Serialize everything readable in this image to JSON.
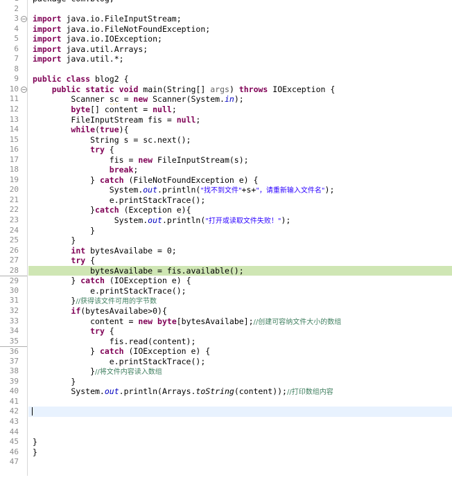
{
  "editor": {
    "language": "java",
    "class_name": "blog2",
    "first_line_number": 1,
    "total_visible_lines": 47,
    "current_line": 42,
    "highlighted_line": 28,
    "colors": {
      "keyword": "#7f0055",
      "string": "#2a00ff",
      "comment": "#3f7f5f",
      "field": "#0000c0",
      "text": "#000000",
      "gutter_text": "#8c8c8c",
      "occurrence_highlight": "#cfe6b4",
      "current_line_highlight": "#e8f2fe",
      "background": "#ffffff",
      "gutter_border": "#d7d7d7",
      "warning_squiggle": "#e8c000"
    },
    "fold_markers": [
      3,
      10
    ],
    "separator_lines": [
      29,
      36
    ],
    "lines": [
      {
        "num": 1,
        "clipped": true,
        "tokens": [
          {
            "t": "package com.blog;",
            "c": "plain"
          }
        ]
      },
      {
        "num": 2,
        "tokens": []
      },
      {
        "num": 3,
        "fold": true,
        "tokens": [
          {
            "t": "import",
            "c": "kw"
          },
          {
            "t": " java.io.FileInputStream;",
            "c": "plain"
          }
        ]
      },
      {
        "num": 4,
        "tokens": [
          {
            "t": "import",
            "c": "kw"
          },
          {
            "t": " java.io.FileNotFoundException;",
            "c": "plain"
          }
        ]
      },
      {
        "num": 5,
        "tokens": [
          {
            "t": "import",
            "c": "kw"
          },
          {
            "t": " java.io.IOException;",
            "c": "plain"
          }
        ]
      },
      {
        "num": 6,
        "tokens": [
          {
            "t": "import",
            "c": "kw"
          },
          {
            "t": " java.util.Arrays;",
            "c": "plain"
          }
        ]
      },
      {
        "num": 7,
        "tokens": [
          {
            "t": "import",
            "c": "kw"
          },
          {
            "t": " java.util.*;",
            "c": "plain"
          }
        ]
      },
      {
        "num": 8,
        "tokens": []
      },
      {
        "num": 9,
        "tokens": [
          {
            "t": "public",
            "c": "kw"
          },
          {
            "t": " ",
            "c": "plain"
          },
          {
            "t": "class",
            "c": "kw"
          },
          {
            "t": " blog2 {",
            "c": "plain"
          }
        ]
      },
      {
        "num": 10,
        "fold": true,
        "tokens": [
          {
            "t": "    ",
            "c": "plain"
          },
          {
            "t": "public",
            "c": "kw"
          },
          {
            "t": " ",
            "c": "plain"
          },
          {
            "t": "static",
            "c": "kw"
          },
          {
            "t": " ",
            "c": "plain"
          },
          {
            "t": "void",
            "c": "kw"
          },
          {
            "t": " main(String[] ",
            "c": "plain"
          },
          {
            "t": "args",
            "c": "ann"
          },
          {
            "t": ") ",
            "c": "plain"
          },
          {
            "t": "throws",
            "c": "kw"
          },
          {
            "t": " IOException {",
            "c": "plain"
          }
        ]
      },
      {
        "num": 11,
        "tokens": [
          {
            "t": "        Scanner ",
            "c": "plain"
          },
          {
            "t": "sc",
            "c": "warn"
          },
          {
            "t": " = ",
            "c": "plain"
          },
          {
            "t": "new",
            "c": "kw"
          },
          {
            "t": " Scanner(System.",
            "c": "plain"
          },
          {
            "t": "in",
            "c": "fld"
          },
          {
            "t": ");",
            "c": "plain"
          }
        ]
      },
      {
        "num": 12,
        "tokens": [
          {
            "t": "        ",
            "c": "plain"
          },
          {
            "t": "byte",
            "c": "kw"
          },
          {
            "t": "[] content = ",
            "c": "plain"
          },
          {
            "t": "null",
            "c": "kw"
          },
          {
            "t": ";",
            "c": "plain"
          }
        ]
      },
      {
        "num": 13,
        "tokens": [
          {
            "t": "        FileInputStream fis = ",
            "c": "plain"
          },
          {
            "t": "null",
            "c": "kw"
          },
          {
            "t": ";",
            "c": "plain"
          }
        ]
      },
      {
        "num": 14,
        "tokens": [
          {
            "t": "        ",
            "c": "plain"
          },
          {
            "t": "while",
            "c": "kw"
          },
          {
            "t": "(",
            "c": "plain"
          },
          {
            "t": "true",
            "c": "kw"
          },
          {
            "t": "){",
            "c": "plain"
          }
        ]
      },
      {
        "num": 15,
        "tokens": [
          {
            "t": "            String s = sc.next();",
            "c": "plain"
          }
        ]
      },
      {
        "num": 16,
        "tokens": [
          {
            "t": "            ",
            "c": "plain"
          },
          {
            "t": "try",
            "c": "kw"
          },
          {
            "t": " {",
            "c": "plain"
          }
        ]
      },
      {
        "num": 17,
        "tokens": [
          {
            "t": "                fis = ",
            "c": "plain"
          },
          {
            "t": "new",
            "c": "kw"
          },
          {
            "t": " FileInputStream(s);",
            "c": "plain"
          }
        ]
      },
      {
        "num": 18,
        "tokens": [
          {
            "t": "                ",
            "c": "plain"
          },
          {
            "t": "break",
            "c": "kw"
          },
          {
            "t": ";",
            "c": "plain"
          }
        ]
      },
      {
        "num": 19,
        "tokens": [
          {
            "t": "            } ",
            "c": "plain"
          },
          {
            "t": "catch",
            "c": "kw"
          },
          {
            "t": " (FileNotFoundException e) {",
            "c": "plain"
          }
        ]
      },
      {
        "num": 20,
        "tokens": [
          {
            "t": "                System.",
            "c": "plain"
          },
          {
            "t": "out",
            "c": "fld"
          },
          {
            "t": ".println(",
            "c": "plain"
          },
          {
            "t": "\"找不到文件\"",
            "c": "str cjk"
          },
          {
            "t": "+s+",
            "c": "plain"
          },
          {
            "t": "\"，请重新输入文件名\"",
            "c": "str cjk"
          },
          {
            "t": ");",
            "c": "plain"
          }
        ]
      },
      {
        "num": 21,
        "tokens": [
          {
            "t": "                e.printStackTrace();",
            "c": "plain"
          }
        ]
      },
      {
        "num": 22,
        "tokens": [
          {
            "t": "            }",
            "c": "plain"
          },
          {
            "t": "catch",
            "c": "kw"
          },
          {
            "t": " (Exception e){",
            "c": "plain"
          }
        ]
      },
      {
        "num": 23,
        "tokens": [
          {
            "t": "                 System.",
            "c": "plain"
          },
          {
            "t": "out",
            "c": "fld"
          },
          {
            "t": ".println(",
            "c": "plain"
          },
          {
            "t": "\"打开或读取文件失败！\"",
            "c": "str cjk"
          },
          {
            "t": ");",
            "c": "plain"
          }
        ]
      },
      {
        "num": 24,
        "tokens": [
          {
            "t": "            }",
            "c": "plain"
          }
        ]
      },
      {
        "num": 25,
        "tokens": [
          {
            "t": "        }",
            "c": "plain"
          }
        ]
      },
      {
        "num": 26,
        "tokens": [
          {
            "t": "        ",
            "c": "plain"
          },
          {
            "t": "int",
            "c": "kw"
          },
          {
            "t": " bytesAvailabe = 0;",
            "c": "plain"
          }
        ]
      },
      {
        "num": 27,
        "tokens": [
          {
            "t": "        ",
            "c": "plain"
          },
          {
            "t": "try",
            "c": "kw"
          },
          {
            "t": " {",
            "c": "plain"
          }
        ]
      },
      {
        "num": 28,
        "highlight": "green",
        "tokens": [
          {
            "t": "            bytesAvailabe = fis.available();",
            "c": "plain"
          }
        ]
      },
      {
        "num": 29,
        "separator": true,
        "tokens": [
          {
            "t": "        } ",
            "c": "plain"
          },
          {
            "t": "catch",
            "c": "kw"
          },
          {
            "t": " (IOException e) {",
            "c": "plain"
          }
        ]
      },
      {
        "num": 30,
        "tokens": [
          {
            "t": "            e.printStackTrace();",
            "c": "plain"
          }
        ]
      },
      {
        "num": 31,
        "tokens": [
          {
            "t": "        }",
            "c": "plain"
          },
          {
            "t": "//获得该文件可用的字节数",
            "c": "cmt cjk"
          }
        ]
      },
      {
        "num": 32,
        "tokens": [
          {
            "t": "        ",
            "c": "plain"
          },
          {
            "t": "if",
            "c": "kw"
          },
          {
            "t": "(bytesAvailabe>0){",
            "c": "plain"
          }
        ]
      },
      {
        "num": 33,
        "tokens": [
          {
            "t": "            content = ",
            "c": "plain"
          },
          {
            "t": "new",
            "c": "kw"
          },
          {
            "t": " ",
            "c": "plain"
          },
          {
            "t": "byte",
            "c": "kw"
          },
          {
            "t": "[bytesAvailabe];",
            "c": "plain"
          },
          {
            "t": "//创建可容纳文件大小的数组",
            "c": "cmt cjk"
          }
        ]
      },
      {
        "num": 34,
        "tokens": [
          {
            "t": "            ",
            "c": "plain"
          },
          {
            "t": "try",
            "c": "kw"
          },
          {
            "t": " {",
            "c": "plain"
          }
        ]
      },
      {
        "num": 35,
        "tokens": [
          {
            "t": "                fis.read(content);",
            "c": "plain"
          }
        ]
      },
      {
        "num": 36,
        "separator": true,
        "tokens": [
          {
            "t": "            } ",
            "c": "plain"
          },
          {
            "t": "catch",
            "c": "kw"
          },
          {
            "t": " (IOException e) {",
            "c": "plain"
          }
        ]
      },
      {
        "num": 37,
        "tokens": [
          {
            "t": "                e.printStackTrace();",
            "c": "plain"
          }
        ]
      },
      {
        "num": 38,
        "tokens": [
          {
            "t": "            }",
            "c": "plain"
          },
          {
            "t": "//将文件内容读入数组",
            "c": "cmt cjk"
          }
        ]
      },
      {
        "num": 39,
        "tokens": [
          {
            "t": "        }",
            "c": "plain"
          }
        ]
      },
      {
        "num": 40,
        "tokens": [
          {
            "t": "        System.",
            "c": "plain"
          },
          {
            "t": "out",
            "c": "fld"
          },
          {
            "t": ".println(Arrays.",
            "c": "plain"
          },
          {
            "t": "toString",
            "c": "stat"
          },
          {
            "t": "(content));",
            "c": "plain"
          },
          {
            "t": "//打印数组内容",
            "c": "cmt cjk"
          }
        ]
      },
      {
        "num": 41,
        "tokens": []
      },
      {
        "num": 42,
        "highlight": "current",
        "caret": true,
        "tokens": []
      },
      {
        "num": 43,
        "tokens": []
      },
      {
        "num": 44,
        "tokens": []
      },
      {
        "num": 45,
        "tokens": [
          {
            "t": "}",
            "c": "plain"
          }
        ]
      },
      {
        "num": 46,
        "tokens": [
          {
            "t": "}",
            "c": "plain"
          }
        ]
      },
      {
        "num": 47,
        "tokens": []
      }
    ]
  }
}
